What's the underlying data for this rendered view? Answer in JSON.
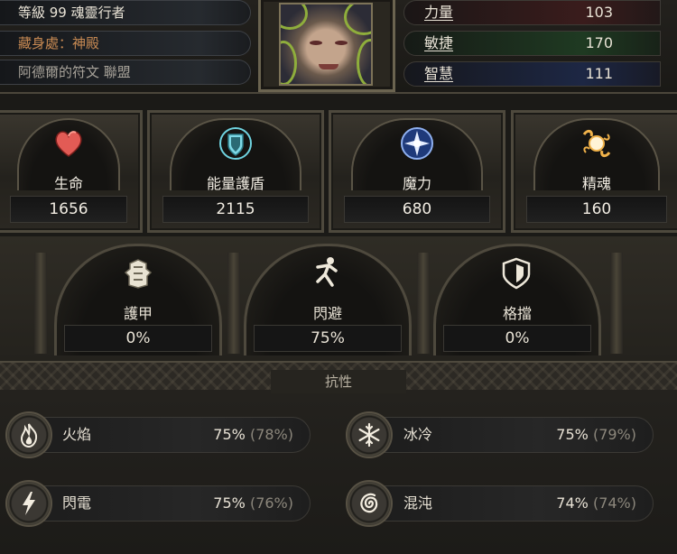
{
  "character": {
    "level_line": "等級 99 魂靈行者",
    "hideout": "藏身處：神殿",
    "league": "阿德爾的符文 聯盟"
  },
  "attributes": [
    {
      "label": "力量",
      "value": "103",
      "color": "#c0392b"
    },
    {
      "label": "敏捷",
      "value": "170",
      "color": "#2e8b3e"
    },
    {
      "label": "智慧",
      "value": "111",
      "color": "#2f5fbf"
    }
  ],
  "stats": [
    {
      "name": "生命",
      "value": "1656",
      "icon": "heart-icon",
      "color": "#d9534f"
    },
    {
      "name": "能量護盾",
      "value": "2115",
      "icon": "shield-icon",
      "color": "#5fc7d6"
    },
    {
      "name": "魔力",
      "value": "680",
      "icon": "mana-icon",
      "color": "#6f8fe0"
    },
    {
      "name": "精魂",
      "value": "160",
      "icon": "spirit-icon",
      "color": "#e8b04a"
    }
  ],
  "defences": [
    {
      "name": "護甲",
      "value": "0%",
      "icon": "armour-icon"
    },
    {
      "name": "閃避",
      "value": "75%",
      "icon": "evasion-icon"
    },
    {
      "name": "格擋",
      "value": "0%",
      "icon": "block-icon"
    }
  ],
  "resistances": {
    "title": "抗性",
    "items": [
      {
        "name": "火焰",
        "value": "75%",
        "cap": "(78%)",
        "icon": "fire-icon"
      },
      {
        "name": "冰冷",
        "value": "75%",
        "cap": "(79%)",
        "icon": "cold-icon"
      },
      {
        "name": "閃電",
        "value": "75%",
        "cap": "(76%)",
        "icon": "lightning-icon"
      },
      {
        "name": "混沌",
        "value": "74%",
        "cap": "(74%)",
        "icon": "chaos-icon"
      }
    ]
  }
}
